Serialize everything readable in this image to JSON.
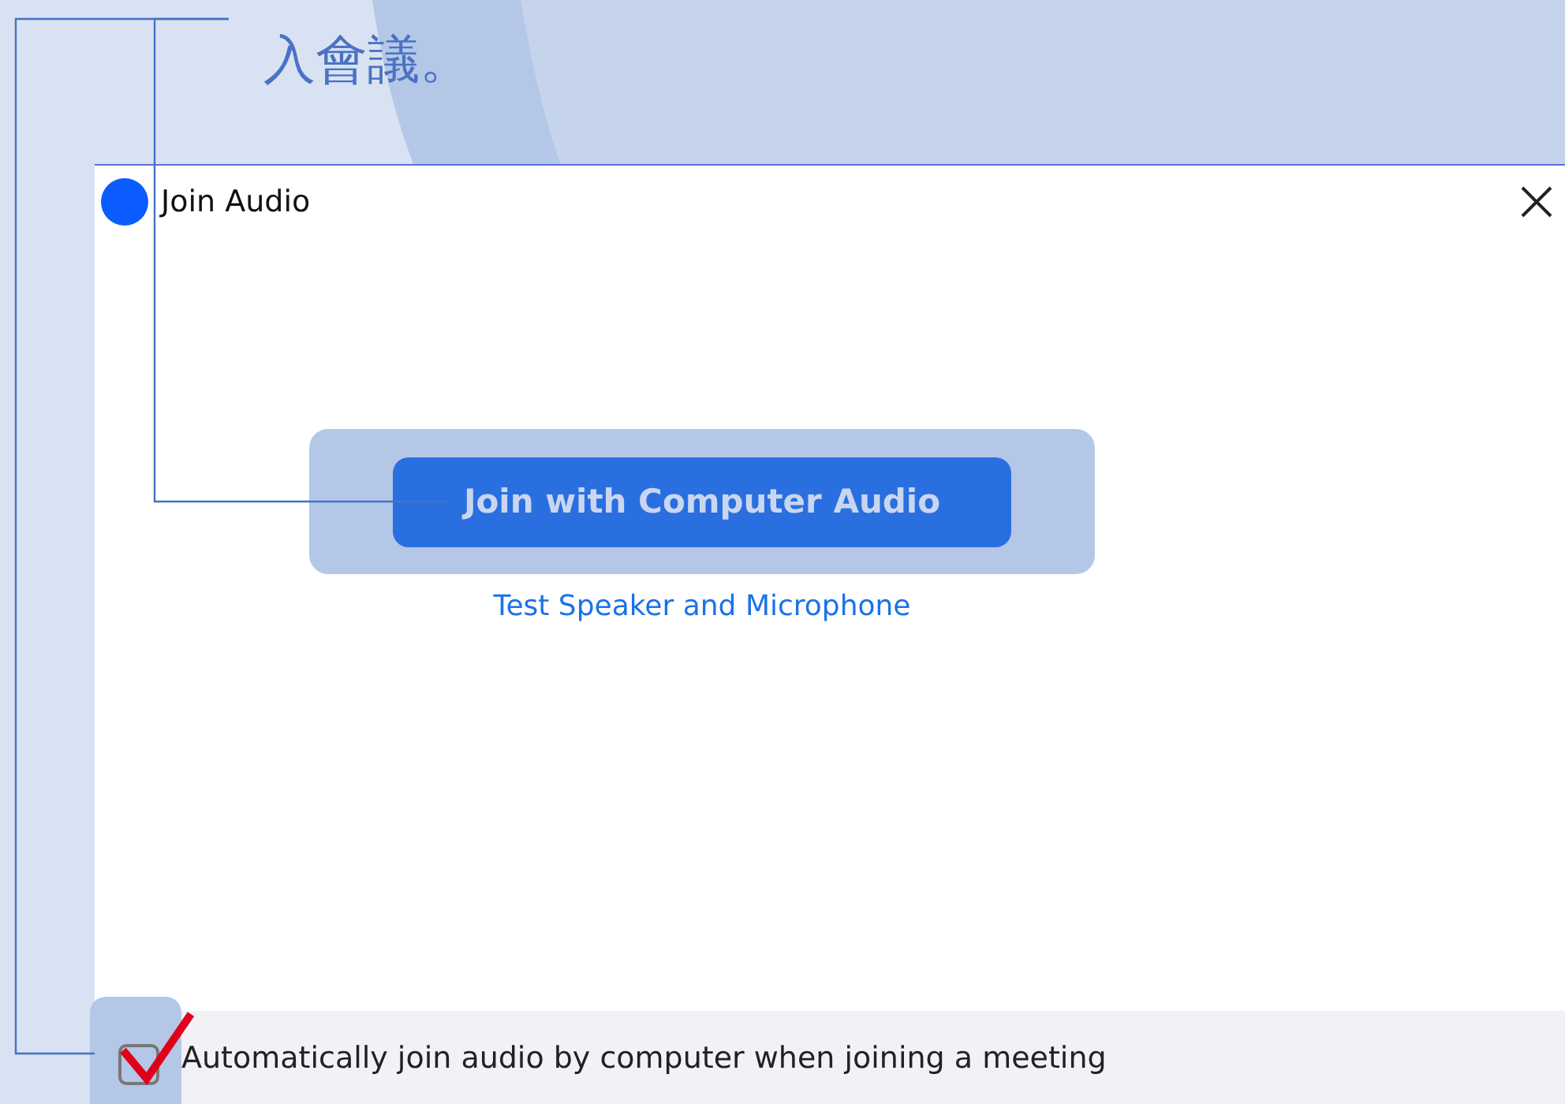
{
  "caption": {
    "text": "入會議。"
  },
  "dialog": {
    "title": "Join Audio",
    "primary_button": "Join with Computer Audio",
    "link": "Test Speaker and Microphone",
    "checkbox": {
      "label": "Automatically join audio by computer when joining a meeting",
      "checked": true
    }
  }
}
